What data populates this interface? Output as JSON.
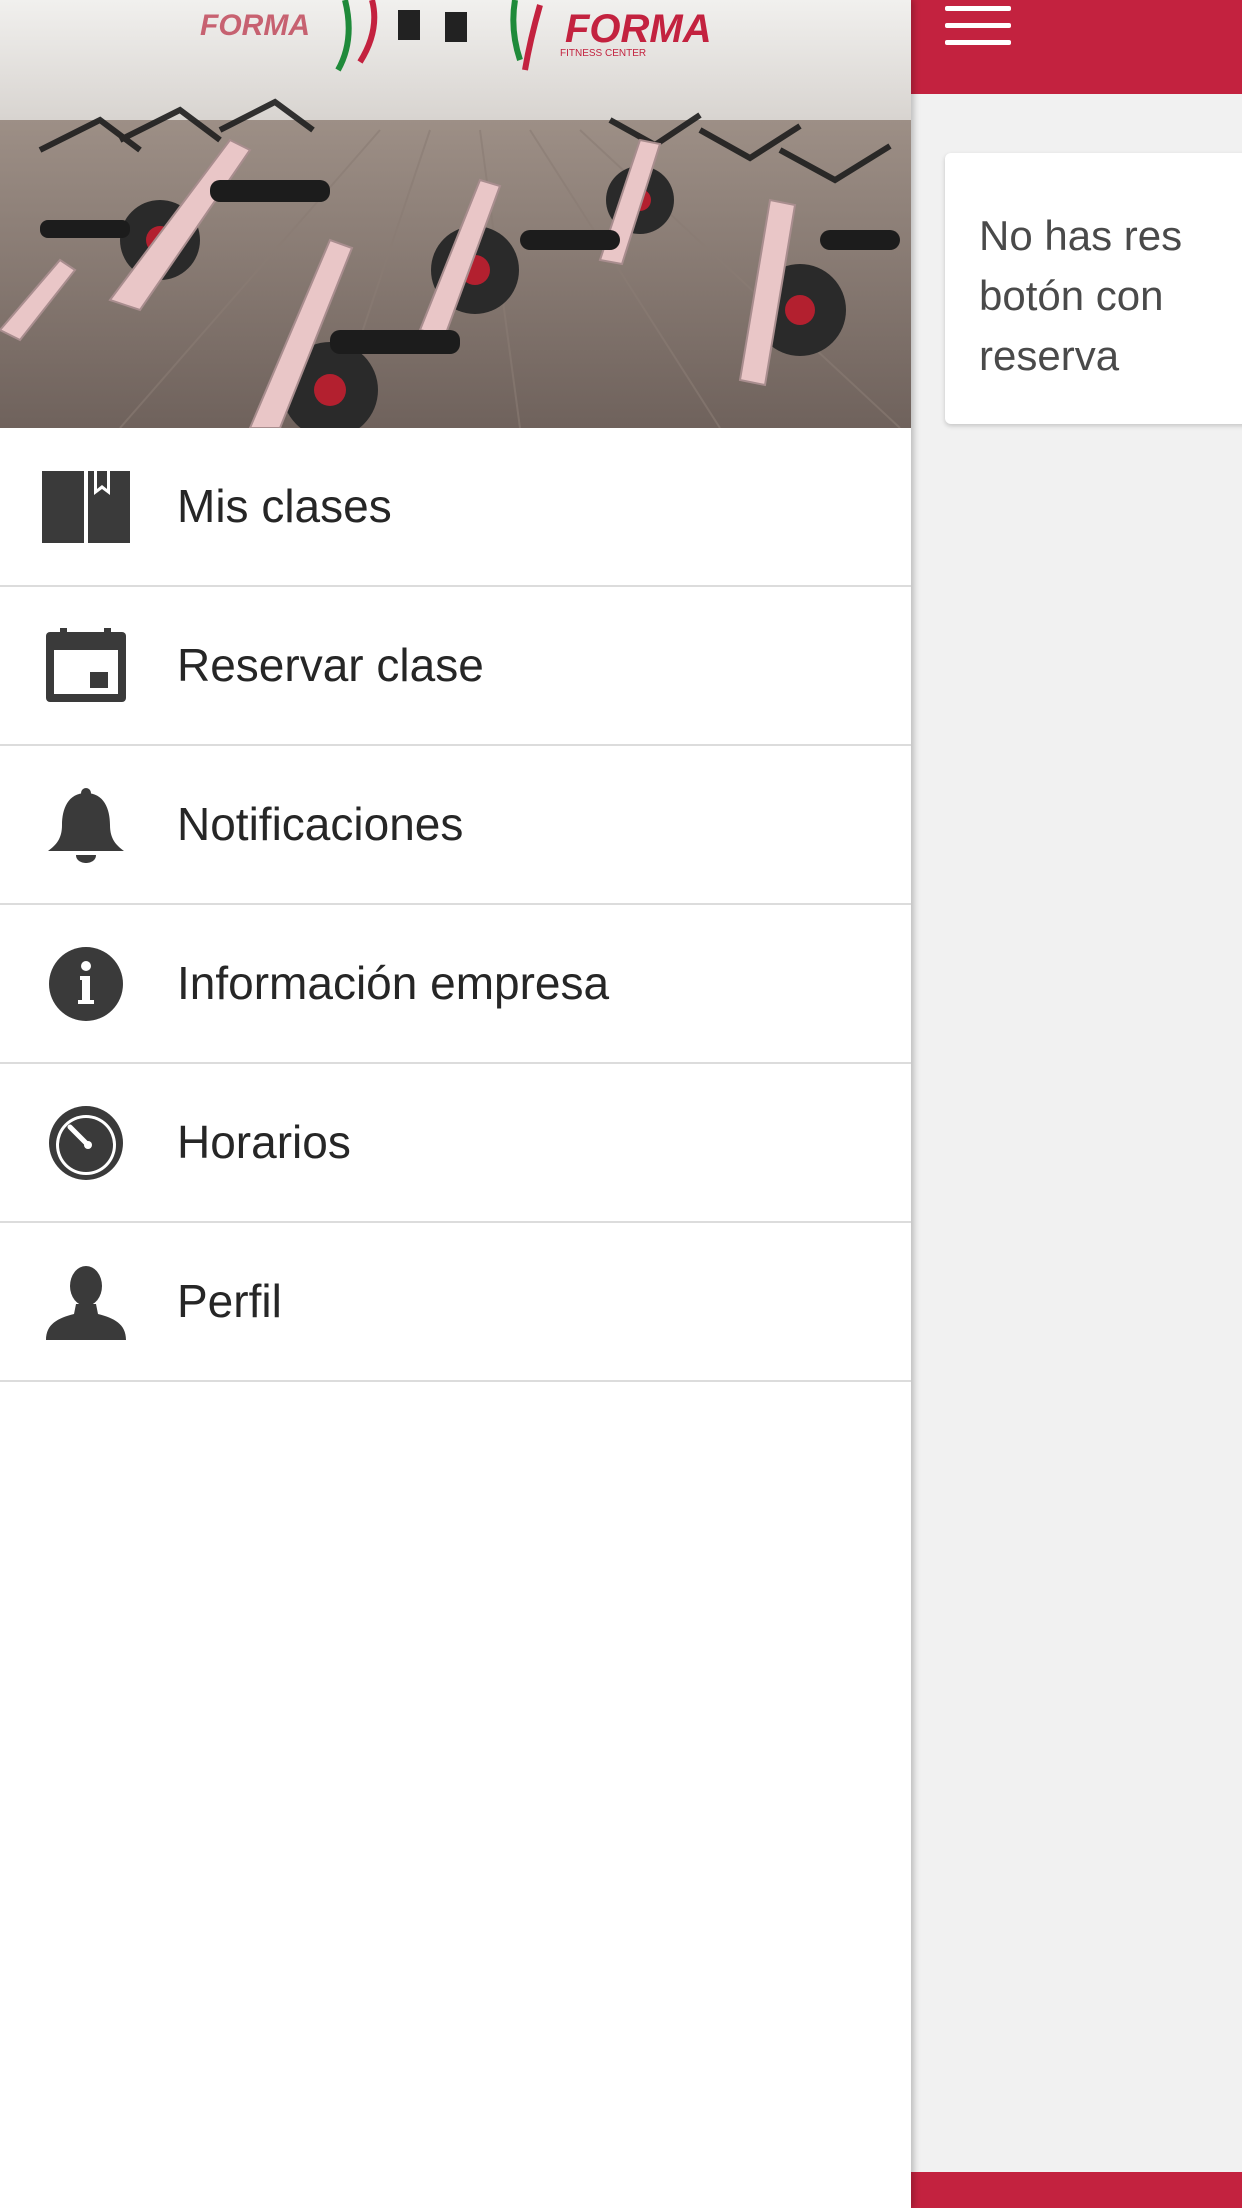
{
  "colors": {
    "accent": "#c3223f",
    "icon": "#3a3a3a",
    "text": "#262626",
    "card_text": "#4a4a4a"
  },
  "drawer": {
    "header_image": {
      "description_icon": "gym-spinning-room-photo",
      "wall_logo_text": "FORMA",
      "wall_logo_subtext": "FITNESS CENTER"
    },
    "items": [
      {
        "label": "Mis clases",
        "icon": "book-icon"
      },
      {
        "label": "Reservar clase",
        "icon": "calendar-icon"
      },
      {
        "label": "Notificaciones",
        "icon": "bell-icon"
      },
      {
        "label": "Información empresa",
        "icon": "info-icon"
      },
      {
        "label": "Horarios",
        "icon": "clock-icon"
      },
      {
        "label": "Perfil",
        "icon": "person-icon"
      }
    ]
  },
  "main": {
    "menu_icon": "hamburger-icon",
    "card": {
      "lines": [
        "No has res",
        "botón con",
        "reserva"
      ]
    }
  }
}
